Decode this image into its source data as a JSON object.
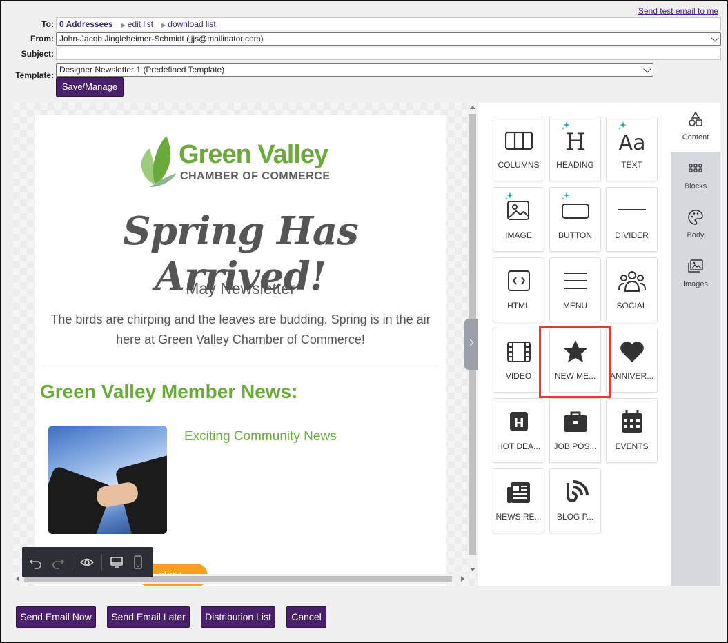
{
  "header": {
    "send_test_link": "Send test email to me",
    "to_label": "To:",
    "to_count": "0 Addressees",
    "edit_list": "edit list",
    "download_list": "download list",
    "from_label": "From:",
    "from_value": "John-Jacob Jingleheimer-Schmidt (jjjs@mailinator.com)",
    "subject_label": "Subject:",
    "subject_value": "",
    "template_label": "Template:",
    "template_value": "Designer Newsletter 1 (Predefined Template)",
    "save_manage": "Save/Manage"
  },
  "email": {
    "logo_title": "Green Valley",
    "logo_subtitle": "CHAMBER OF COMMERCE",
    "hero": "Spring Has Arrived!",
    "subtitle": "May Newsletter",
    "body": "The birds are chirping and the leaves are budding. Spring is in the air here at Green Valley Chamber of Commerce!",
    "section_title": "Green Valley Member News:",
    "story_title": "Exciting Community News",
    "story_button": "ctory"
  },
  "content_tiles": [
    {
      "label": "COLUMNS",
      "icon": "columns-icon"
    },
    {
      "label": "HEADING",
      "icon": "heading-icon"
    },
    {
      "label": "TEXT",
      "icon": "text-icon"
    },
    {
      "label": "IMAGE",
      "icon": "image-icon"
    },
    {
      "label": "BUTTON",
      "icon": "button-icon"
    },
    {
      "label": "DIVIDER",
      "icon": "divider-icon"
    },
    {
      "label": "HTML",
      "icon": "html-icon"
    },
    {
      "label": "MENU",
      "icon": "menu-icon"
    },
    {
      "label": "SOCIAL",
      "icon": "social-icon"
    },
    {
      "label": "VIDEO",
      "icon": "video-icon"
    },
    {
      "label": "NEW ME...",
      "icon": "star-icon"
    },
    {
      "label": "ANNIVER...",
      "icon": "heart-icon"
    },
    {
      "label": "HOT DEA...",
      "icon": "hot-deals-icon"
    },
    {
      "label": "JOB POS...",
      "icon": "briefcase-icon"
    },
    {
      "label": "EVENTS",
      "icon": "calendar-icon"
    },
    {
      "label": "NEWS RE...",
      "icon": "newspaper-icon"
    },
    {
      "label": "BLOG P...",
      "icon": "blog-icon"
    }
  ],
  "side_tabs": [
    {
      "label": "Content",
      "icon": "shapes-icon",
      "active": true
    },
    {
      "label": "Blocks",
      "icon": "grid-icon",
      "active": false
    },
    {
      "label": "Body",
      "icon": "palette-icon",
      "active": false
    },
    {
      "label": "Images",
      "icon": "images-icon",
      "active": false
    }
  ],
  "footer": {
    "send_now": "Send Email Now",
    "send_later": "Send Email Later",
    "distribution_list": "Distribution List",
    "cancel": "Cancel"
  },
  "colors": {
    "brand_purple": "#4a1f6b",
    "green": "#6aaa3a",
    "orange": "#f5a11e",
    "highlight_red": "#e53935",
    "sparkle_teal": "#1aa89a"
  }
}
